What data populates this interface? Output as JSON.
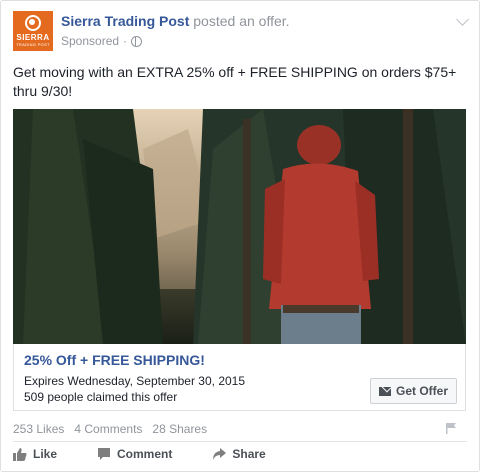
{
  "post": {
    "page_name": "Sierra Trading Post",
    "action_text": "posted an offer.",
    "sponsored_label": "Sponsored",
    "separator": "·",
    "logo_text": "SIERRA",
    "logo_subtext": "TRADING POST",
    "message": "Get moving with an EXTRA 25% off + FREE SHIPPING on orders $75+ thru 9/30!"
  },
  "offer": {
    "title": "25% Off + FREE SHIPPING!",
    "expires": "Expires Wednesday, September 30, 2015",
    "claimed": "509 people claimed this offer",
    "button_label": "Get Offer"
  },
  "stats": {
    "likes": "253 Likes",
    "comments": "4 Comments",
    "shares": "28 Shares"
  },
  "actions": {
    "like": "Like",
    "comment": "Comment",
    "share": "Share"
  },
  "colors": {
    "brand_orange": "#e46a1f",
    "link_blue": "#365899",
    "muted_gray": "#90949c"
  }
}
